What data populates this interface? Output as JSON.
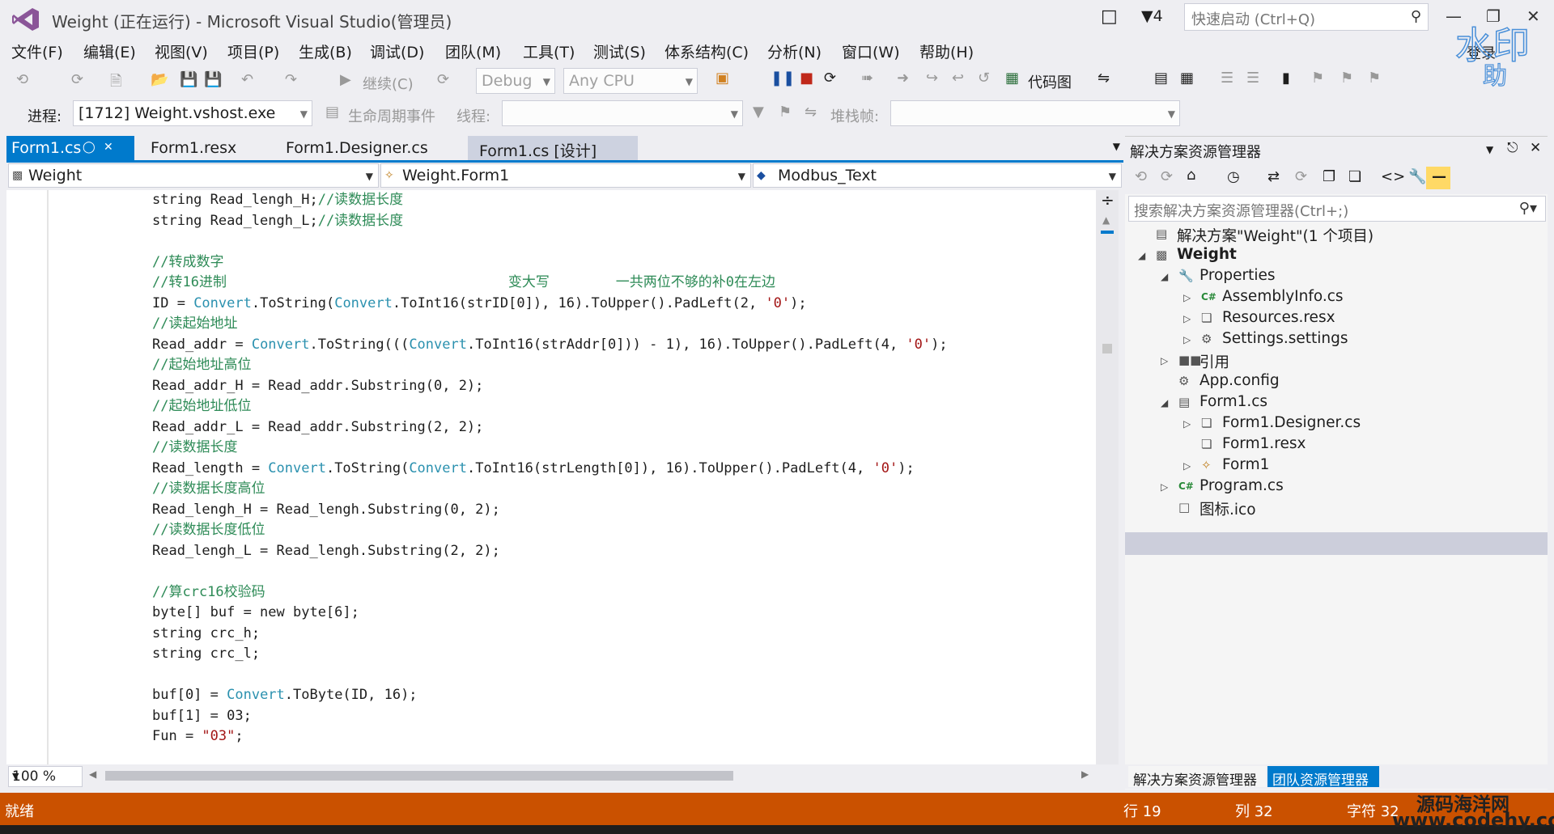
{
  "window": {
    "title": "Weight (正在运行) - Microsoft Visual Studio(管理员)",
    "notification_count": "4",
    "quick_launch_placeholder": "快速启动 (Ctrl+Q)",
    "sign_in": "登录"
  },
  "menu": [
    "文件(F)",
    "编辑(E)",
    "视图(V)",
    "项目(P)",
    "生成(B)",
    "调试(D)",
    "团队(M)",
    "工具(T)",
    "测试(S)",
    "体系结构(C)",
    "分析(N)",
    "窗口(W)",
    "帮助(H)"
  ],
  "toolbar": {
    "continue": "继续(C)",
    "config": "Debug",
    "platform": "Any CPU",
    "code_map": "代码图"
  },
  "debug_location": {
    "process_label": "进程:",
    "process_value": "[1712] Weight.vshost.exe",
    "lifecycle_events": "生命周期事件",
    "thread_label": "线程:",
    "stack_frame_label": "堆栈帧:"
  },
  "tabs": [
    {
      "label": "Form1.cs"
    },
    {
      "label": "Form1.resx"
    },
    {
      "label": "Form1.Designer.cs"
    },
    {
      "label": "Form1.cs [设计]"
    }
  ],
  "navbar": {
    "project": "Weight",
    "type": "Weight.Form1",
    "member": "Modbus_Text"
  },
  "code_lines": [
    [
      [
        "",
        "string Read_lengh_H;"
      ],
      [
        "cm",
        "//读数据长度"
      ]
    ],
    [
      [
        "",
        "string Read_lengh_L;"
      ],
      [
        "cm",
        "//读数据长度"
      ]
    ],
    [],
    [
      [
        "cm",
        "//转成数字"
      ]
    ],
    [
      [
        "cm",
        "//转16进制                                  变大写        一共两位不够的补0在左边"
      ]
    ],
    [
      [
        "",
        "ID = "
      ],
      [
        "ty",
        "Convert"
      ],
      [
        "",
        ".ToString("
      ],
      [
        "ty",
        "Convert"
      ],
      [
        "",
        ".ToInt16(strID[0]), 16).ToUpper().PadLeft(2, "
      ],
      [
        "st",
        "'0'"
      ],
      [
        "",
        ");"
      ]
    ],
    [
      [
        "cm",
        "//读起始地址"
      ]
    ],
    [
      [
        "",
        "Read_addr = "
      ],
      [
        "ty",
        "Convert"
      ],
      [
        "",
        ".ToString((("
      ],
      [
        "ty",
        "Convert"
      ],
      [
        "",
        ".ToInt16(strAddr[0])) - 1), 16).ToUpper().PadLeft(4, "
      ],
      [
        "st",
        "'0'"
      ],
      [
        "",
        ");"
      ]
    ],
    [
      [
        "cm",
        "//起始地址高位"
      ]
    ],
    [
      [
        "",
        "Read_addr_H = Read_addr.Substring(0, 2);"
      ]
    ],
    [
      [
        "cm",
        "//起始地址低位"
      ]
    ],
    [
      [
        "",
        "Read_addr_L = Read_addr.Substring(2, 2);"
      ]
    ],
    [
      [
        "cm",
        "//读数据长度"
      ]
    ],
    [
      [
        "",
        "Read_length = "
      ],
      [
        "ty",
        "Convert"
      ],
      [
        "",
        ".ToString("
      ],
      [
        "ty",
        "Convert"
      ],
      [
        "",
        ".ToInt16(strLength[0]), 16).ToUpper().PadLeft(4, "
      ],
      [
        "st",
        "'0'"
      ],
      [
        "",
        ");"
      ]
    ],
    [
      [
        "cm",
        "//读数据长度高位"
      ]
    ],
    [
      [
        "",
        "Read_lengh_H = Read_lengh.Substring(0, 2);"
      ]
    ],
    [
      [
        "cm",
        "//读数据长度低位"
      ]
    ],
    [
      [
        "",
        "Read_lengh_L = Read_lengh.Substring(2, 2);"
      ]
    ],
    [],
    [
      [
        "cm",
        "//算crc16校验码"
      ]
    ],
    [
      [
        "",
        "byte[] buf = new byte[6];"
      ]
    ],
    [
      [
        "",
        "string crc_h;"
      ]
    ],
    [
      [
        "",
        "string crc_l;"
      ]
    ],
    [],
    [
      [
        "",
        "buf[0] = "
      ],
      [
        "ty",
        "Convert"
      ],
      [
        "",
        ".ToByte(ID, 16);"
      ]
    ],
    [
      [
        "",
        "buf[1] = 03;"
      ]
    ],
    [
      [
        "",
        "Fun = "
      ],
      [
        "st",
        "\"03\""
      ],
      [
        "",
        ";"
      ]
    ]
  ],
  "zoom": "100 %",
  "solution_explorer": {
    "title": "解决方案资源管理器",
    "search_placeholder": "搜索解决方案资源管理器(Ctrl+;)",
    "tree": [
      {
        "label": "解决方案\"Weight\"(1 个项目)",
        "icon": "solution-icon",
        "level": 0,
        "arrow": ""
      },
      {
        "label": "Weight",
        "icon": "csharp-project-icon",
        "level": 0,
        "arrow": "▲",
        "bold": true
      },
      {
        "label": "Properties",
        "icon": "wrench-icon",
        "level": 1,
        "arrow": "▲"
      },
      {
        "label": "AssemblyInfo.cs",
        "icon": "csharp-file-icon",
        "level": 2,
        "arrow": "▷"
      },
      {
        "label": "Resources.resx",
        "icon": "resx-icon",
        "level": 2,
        "arrow": "▷"
      },
      {
        "label": "Settings.settings",
        "icon": "gear-icon",
        "level": 2,
        "arrow": "▷"
      },
      {
        "label": "引用",
        "icon": "references-icon",
        "level": 1,
        "arrow": "▷"
      },
      {
        "label": "App.config",
        "icon": "config-icon",
        "level": 1,
        "arrow": ""
      },
      {
        "label": "Form1.cs",
        "icon": "form-icon",
        "level": 1,
        "arrow": "▲",
        "selected": true
      },
      {
        "label": "Form1.Designer.cs",
        "icon": "designer-icon",
        "level": 2,
        "arrow": "▷"
      },
      {
        "label": "Form1.resx",
        "icon": "resx-icon",
        "level": 2,
        "arrow": ""
      },
      {
        "label": "Form1",
        "icon": "class-icon",
        "level": 2,
        "arrow": "▷"
      },
      {
        "label": "Program.cs",
        "icon": "csharp-file-icon",
        "level": 1,
        "arrow": "▷"
      },
      {
        "label": "图标.ico",
        "icon": "ico-file-icon",
        "level": 1,
        "arrow": ""
      }
    ],
    "bottom_tabs": [
      "解决方案资源管理器",
      "团队资源管理器"
    ]
  },
  "status": {
    "ready": "就绪",
    "line": "行 19",
    "col": "列 32",
    "char": "字符 32"
  },
  "watermark": {
    "site_name": "源码海洋网",
    "site_url": "www.codehy.com"
  },
  "colors": {
    "accent": "#007acc",
    "status_bar": "#ca5100",
    "comment": "#2e8b57",
    "type": "#2b91af",
    "string": "#a31515"
  }
}
